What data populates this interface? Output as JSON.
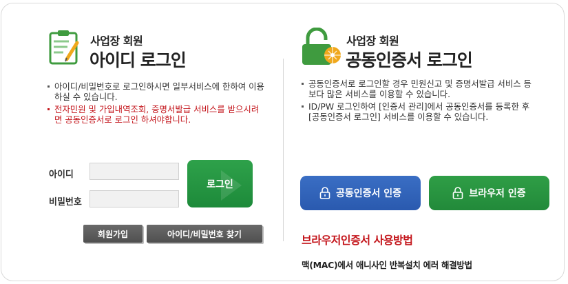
{
  "left": {
    "subtitle": "사업장 회원",
    "title": "아이디 로그인",
    "bullets": [
      {
        "text": "아이디/비밀번호로 로그인하시면 일부서비스에 한하여 이용하실 수 있습니다.",
        "emphasis": false
      },
      {
        "text": "전자민원 및 가입내역조회, 증명서발급 서비스를 받으시려면 공동인증서로 로그인 하셔야합니다.",
        "emphasis": true
      }
    ],
    "id_label": "아이디",
    "id_value": "",
    "pw_label": "비밀번호",
    "pw_value": "",
    "login_button": "로그인",
    "join_button": "회원가입",
    "find_button": "아이디/비밀번호 찾기"
  },
  "right": {
    "subtitle": "사업장 회원",
    "title": "공동인증서 로그인",
    "bullets": [
      {
        "text": "공동인증서로 로그인할 경우 민원신고 및 증명서발급 서비스 등 보다 많은 서비스를 이용할 수 있습니다."
      },
      {
        "text": "ID/PW 로그인하여 [인증서 관리]에서 공동인증서를 등록한 후 [공동인증서 로그인] 서비스를 이용할 수 있습니다."
      }
    ],
    "cert_button": "공동인증서 인증",
    "browser_button": "브라우저 인증",
    "browser_howto_link": "브라우저인증서 사용방법",
    "mac_link": "맥(MAC)에서 애니사인 반복설치 에러 해결방법"
  },
  "colors": {
    "accent_green": "#2ea14a",
    "accent_blue": "#2a5aaf",
    "warning_red": "#c4161c",
    "dark_button": "#555555"
  },
  "icons": {
    "left_header": "clipboard-check-icon",
    "right_header": "lock-certificate-icon",
    "button_lock": "lock-icon"
  }
}
